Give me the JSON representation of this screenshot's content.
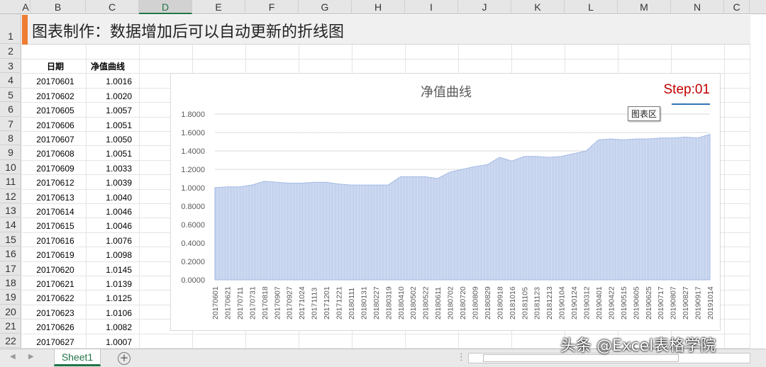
{
  "sheet": {
    "columns": [
      "A",
      "B",
      "C",
      "D",
      "E",
      "F",
      "G",
      "H",
      "I",
      "J",
      "K",
      "L",
      "M",
      "N",
      "C"
    ],
    "rows": [
      "1",
      "2",
      "3",
      "4",
      "5",
      "6",
      "7",
      "8",
      "9",
      "10",
      "11",
      "12",
      "13",
      "14",
      "15",
      "16",
      "17",
      "18",
      "19",
      "20",
      "21",
      "22"
    ],
    "title": "图表制作：数据增加后可以自动更新的折线图",
    "header_date": "日期",
    "header_nav": "净值曲线",
    "dates": [
      "20170601",
      "20170602",
      "20170605",
      "20170606",
      "20170607",
      "20170608",
      "20170609",
      "20170612",
      "20170613",
      "20170614",
      "20170615",
      "20170616",
      "20170619",
      "20170620",
      "20170621",
      "20170622",
      "20170623",
      "20170626",
      "20170627"
    ],
    "values": [
      "1.0016",
      "1.0020",
      "1.0057",
      "1.0051",
      "1.0050",
      "1.0051",
      "1.0033",
      "1.0039",
      "1.0040",
      "1.0046",
      "1.0046",
      "1.0076",
      "1.0098",
      "1.0145",
      "1.0139",
      "1.0125",
      "1.0106",
      "1.0082",
      "1.0007"
    ]
  },
  "chart_data": {
    "type": "area",
    "title": "净值曲线",
    "step_label": "Step:01",
    "tooltip": "图表区",
    "ylim": [
      0,
      1.8
    ],
    "y_ticks": [
      "0.0000",
      "0.2000",
      "0.4000",
      "0.6000",
      "0.8000",
      "1.0000",
      "1.2000",
      "1.4000",
      "1.6000",
      "1.8000"
    ],
    "x_tick_labels": [
      "20170601",
      "20170621",
      "20170711",
      "20170731",
      "20170818",
      "20170907",
      "20170927",
      "20171024",
      "20171113",
      "20171201",
      "20171221",
      "20180111",
      "20180131",
      "20180227",
      "20180319",
      "20180410",
      "20180502",
      "20180522",
      "20180611",
      "20180702",
      "20180720",
      "20180809",
      "20180829",
      "20180918",
      "20181016",
      "20181105",
      "20181123",
      "20181213",
      "20190104",
      "20190124",
      "20190312",
      "20190401",
      "20190422",
      "20190515",
      "20190605",
      "20190625",
      "20190717",
      "20190807",
      "20190827",
      "20190917",
      "20191014"
    ],
    "series": [
      {
        "color": "#c5d3ee",
        "values": [
          1.0,
          1.01,
          1.01,
          1.03,
          1.07,
          1.06,
          1.05,
          1.05,
          1.06,
          1.06,
          1.04,
          1.03,
          1.03,
          1.03,
          1.03,
          1.12,
          1.12,
          1.12,
          1.1,
          1.17,
          1.2,
          1.23,
          1.25,
          1.33,
          1.29,
          1.34,
          1.34,
          1.33,
          1.34,
          1.37,
          1.4,
          1.52,
          1.53,
          1.52,
          1.53,
          1.53,
          1.54,
          1.54,
          1.55,
          1.54,
          1.58
        ]
      }
    ],
    "grid": true
  },
  "tabs": {
    "sheet_name": "Sheet1",
    "add_symbol": "+"
  },
  "watermark": "头条 @Excel表格学院",
  "colors": {
    "accent": "#ed7d31",
    "excel_green": "#217346",
    "step_red": "#c00000",
    "area_fill": "#c5d3ee"
  }
}
